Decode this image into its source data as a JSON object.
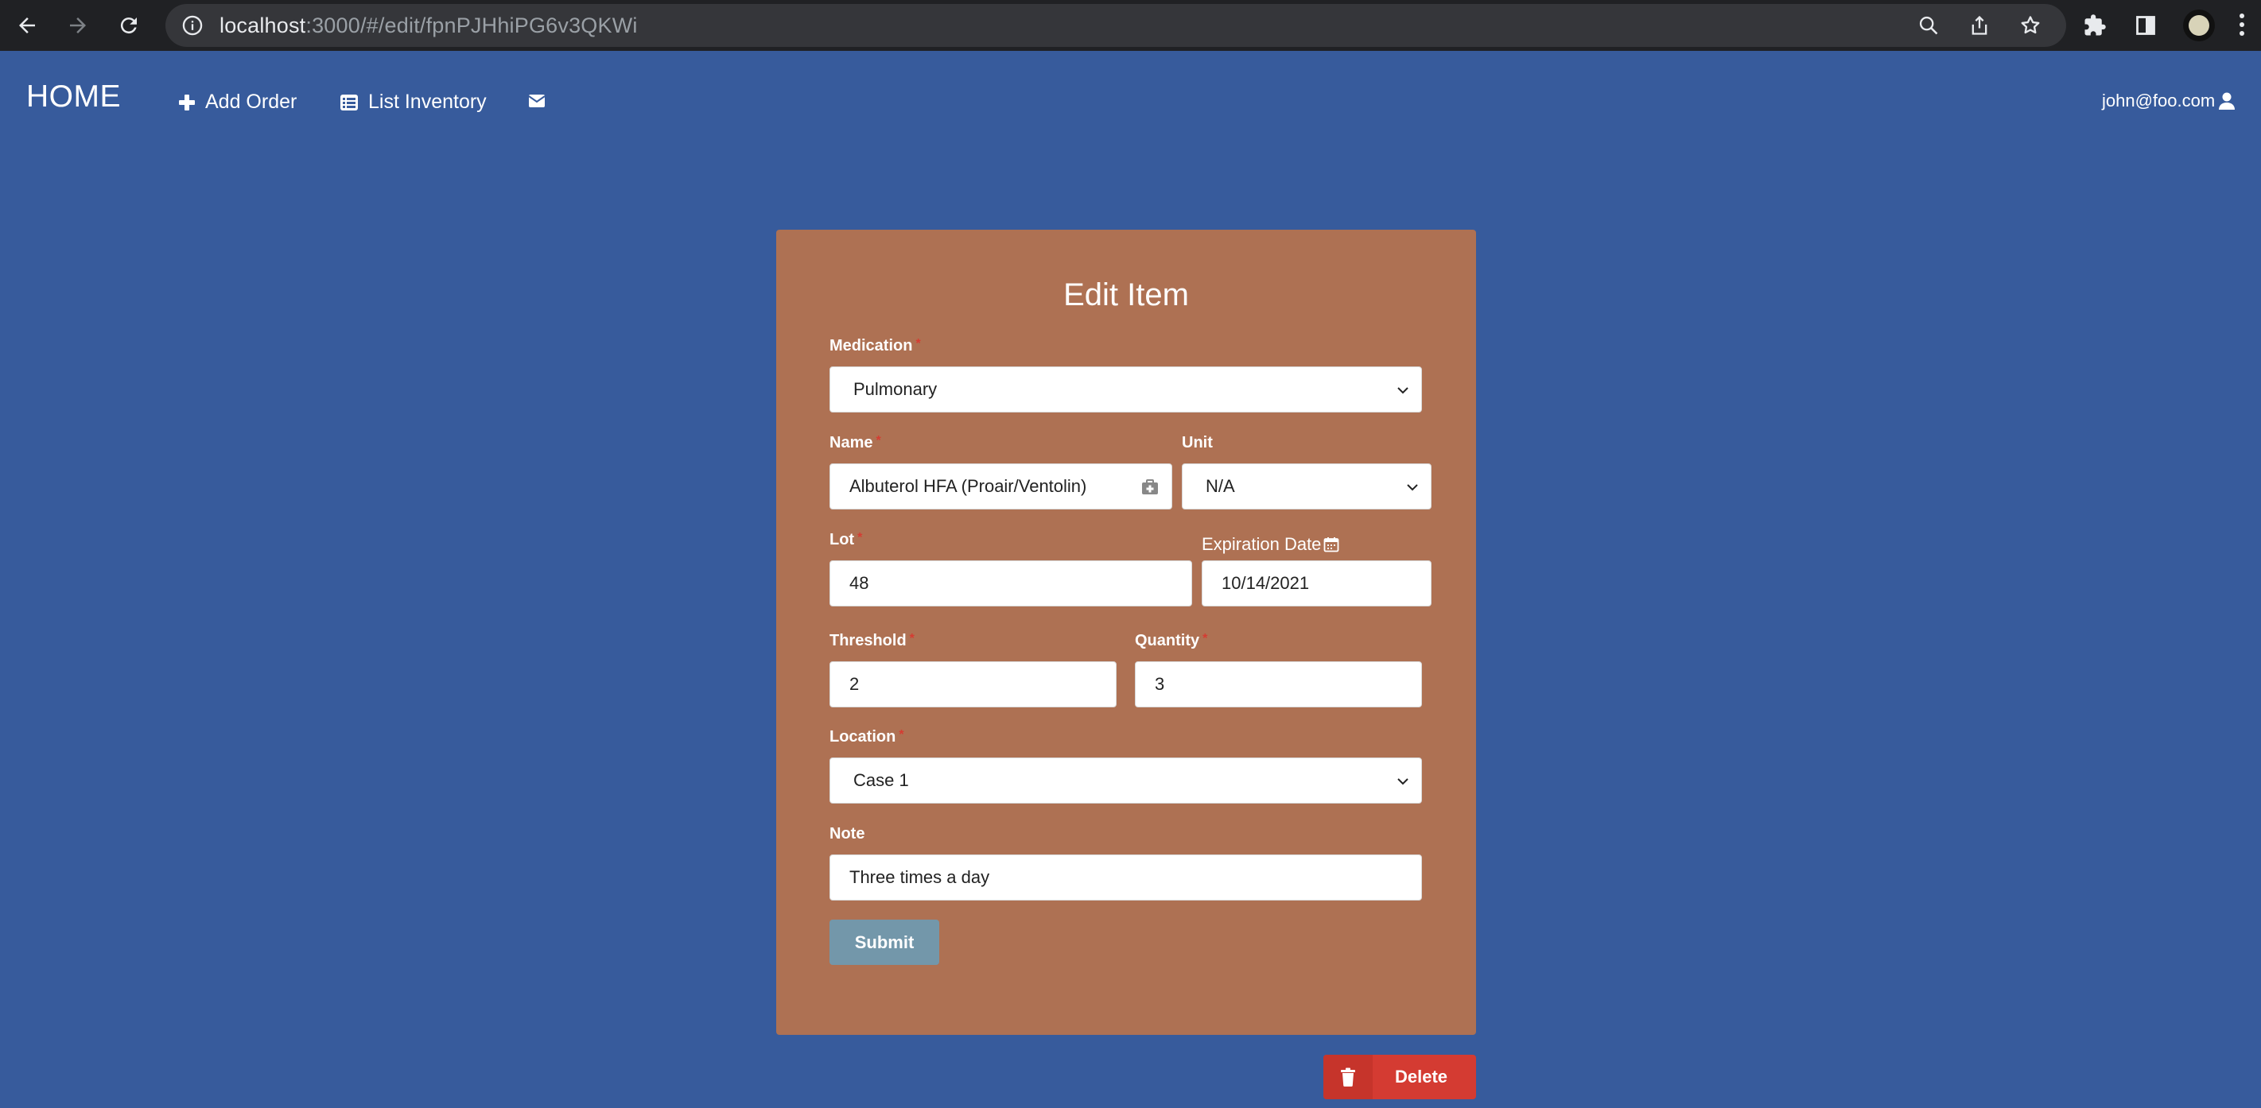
{
  "browser": {
    "url_host": "localhost",
    "url_path": ":3000/#/edit/fpnPJHhiPG6v3QKWi"
  },
  "nav": {
    "brand": "HOME",
    "add_order": "Add Order",
    "list_inventory": "List Inventory",
    "user_email": "john@foo.com"
  },
  "form": {
    "title": "Edit Item",
    "medication": {
      "label": "Medication",
      "value": "Pulmonary"
    },
    "name": {
      "label": "Name",
      "value": "Albuterol HFA (Proair/Ventolin)"
    },
    "unit": {
      "label": "Unit",
      "value": "N/A"
    },
    "lot": {
      "label": "Lot",
      "value": "48"
    },
    "expiration": {
      "label": "Expiration Date",
      "value": "10/14/2021"
    },
    "threshold": {
      "label": "Threshold",
      "value": "2"
    },
    "quantity": {
      "label": "Quantity",
      "value": "3"
    },
    "location": {
      "label": "Location",
      "value": "Case 1"
    },
    "note": {
      "label": "Note",
      "value": "Three times a day"
    },
    "submit_label": "Submit",
    "required_mark": "*"
  },
  "delete_label": "Delete",
  "colors": {
    "background": "#375b9c",
    "card": "#ae7153",
    "submit": "#7397aa",
    "delete": "#d43b32",
    "required": "#d63b32"
  }
}
